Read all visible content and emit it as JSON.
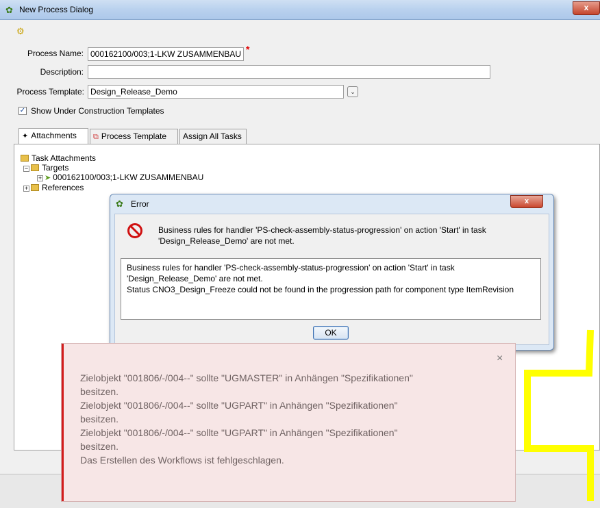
{
  "window": {
    "title": "New Process Dialog",
    "close_label": "x"
  },
  "form": {
    "process_name_label": "Process Name:",
    "process_name_value": "000162100/003;1-LKW ZUSAMMENBAU",
    "required_marker": "*",
    "description_label": "Description:",
    "description_value": "",
    "template_label": "Process Template:",
    "template_value": "Design_Release_Demo",
    "show_under_construction_label": "Show Under Construction Templates",
    "show_under_construction_checked": true
  },
  "tabs": [
    {
      "label": "Attachments",
      "active": true
    },
    {
      "label": "Process Template",
      "active": false
    },
    {
      "label": "Assign All Tasks",
      "active": false
    }
  ],
  "tree": {
    "root": "Task Attachments",
    "targets": "Targets",
    "target_item": "000162100/003;1-LKW ZUSAMMENBAU",
    "references": "References"
  },
  "error_dialog": {
    "title": "Error",
    "close_label": "x",
    "summary_line1": "Business rules for handler 'PS-check-assembly-status-progression' on action 'Start' in task",
    "summary_line2": "'Design_Release_Demo' are not met.",
    "details": [
      "Business rules for handler 'PS-check-assembly-status-progression' on action 'Start' in task",
      "'Design_Release_Demo' are not met.",
      "Status CNO3_Design_Freeze could not be found in the progression path for component type ItemRevision"
    ],
    "ok_label": "OK"
  },
  "notification": {
    "close_label": "×",
    "lines": [
      "Zielobjekt \"001806/-/004--\" sollte \"UGMASTER\" in Anhängen \"Spezifikationen\"",
      "besitzen.",
      "Zielobjekt \"001806/-/004--\" sollte \"UGPART\" in Anhängen \"Spezifikationen\"",
      "besitzen.",
      "Zielobjekt \"001806/-/004--\" sollte \"UGPART\" in Anhängen \"Spezifikationen\"",
      "besitzen.",
      "Das Erstellen des Workflows ist fehlgeschlagen."
    ]
  },
  "colors": {
    "accent_error": "#d21c1c",
    "annotation_arrow": "#ffff00"
  }
}
